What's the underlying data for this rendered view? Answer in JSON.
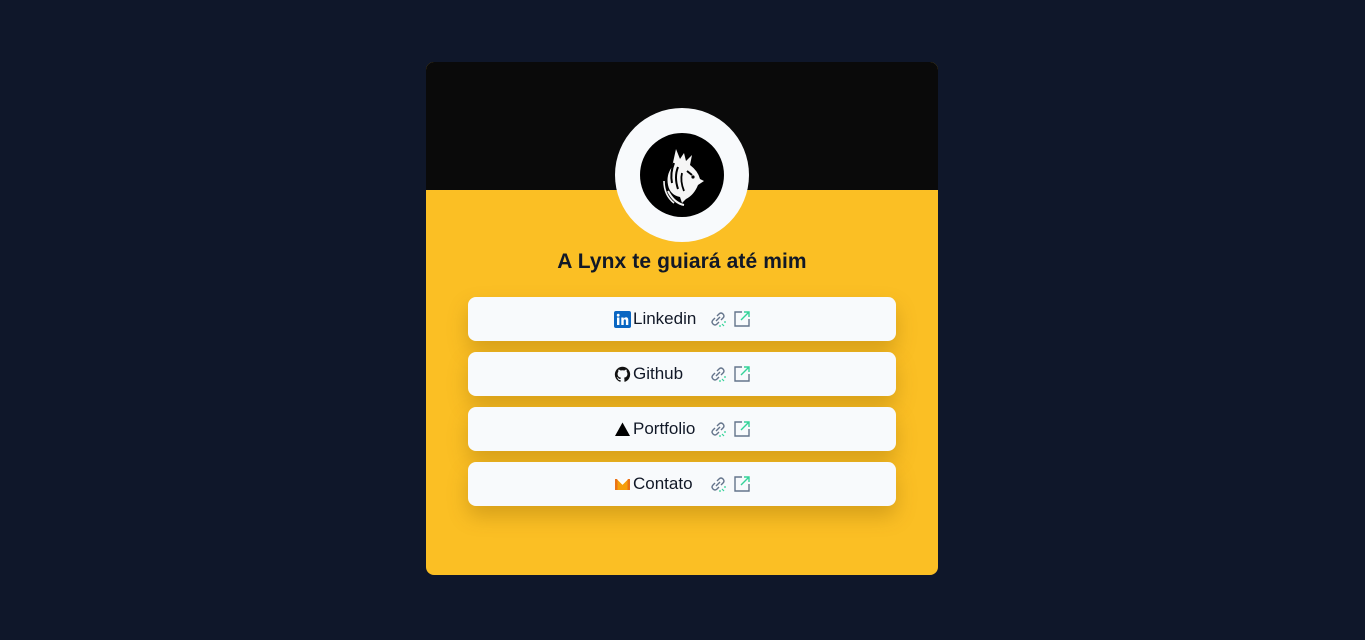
{
  "heading": "A Lynx te guiará até mim",
  "links": [
    {
      "label": "Linkedin",
      "icon": "linkedin-icon"
    },
    {
      "label": "Github",
      "icon": "github-icon"
    },
    {
      "label": "Portfolio",
      "icon": "vercel-triangle-icon"
    },
    {
      "label": "Contato",
      "icon": "mail-icon"
    }
  ],
  "trailing_icons": [
    "link-icon",
    "external-link-icon"
  ],
  "colors": {
    "page_bg": "#0f172a",
    "card_header": "#0a0a0a",
    "card_body": "#fbbf24",
    "button_bg": "#f8fafc",
    "linkedin": "#0a66c2",
    "mail": "#ea7317",
    "trail_icon": "#64748b",
    "trail_accent": "#34d399"
  }
}
